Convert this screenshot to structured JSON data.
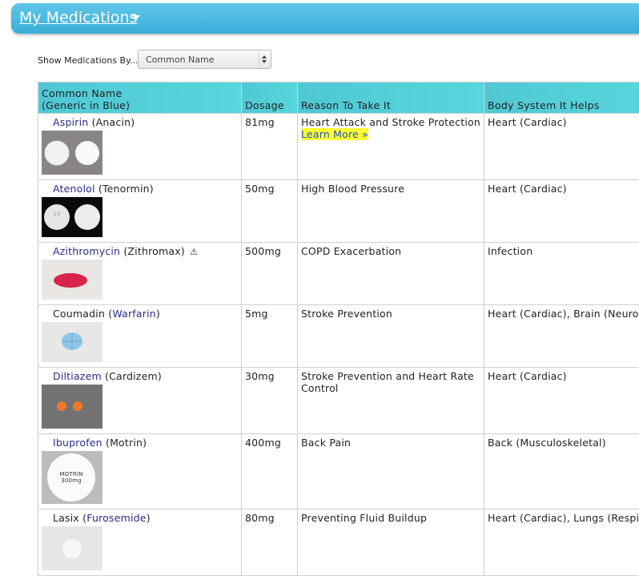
{
  "header": {
    "title": "My Medications"
  },
  "filter": {
    "label": "Show Medications By...",
    "selected": "Common Name"
  },
  "table": {
    "columns": [
      "Common Name\n(Generic in Blue)",
      "Dosage",
      "Reason To Take It",
      "Body System It Helps"
    ],
    "rows": [
      {
        "name_pre": "",
        "name_blue": "Aspirin",
        "name_post": " (Anacin)",
        "dosage": "81mg",
        "reason": "Heart Attack and Stroke Protection",
        "learn_more": "Learn More »",
        "body": "Heart (Cardiac)",
        "pill": "aspirin"
      },
      {
        "name_pre": "",
        "name_blue": "Atenolol",
        "name_post": " (Tenormin)",
        "dosage": "50mg",
        "reason": "High Blood Pressure",
        "learn_more": "",
        "body": "Heart (Cardiac)",
        "pill": "atenolol"
      },
      {
        "name_pre": "",
        "name_blue": "Azithromycin",
        "name_post": " (Zithromax)",
        "dosage": "500mg",
        "reason": "COPD Exacerbation",
        "learn_more": "",
        "body": "Infection",
        "pill": "azithromycin",
        "warning": "⚠"
      },
      {
        "name_pre": "Coumadin (",
        "name_blue": "Warfarin",
        "name_post": ")",
        "dosage": "5mg",
        "reason": "Stroke Prevention",
        "learn_more": "",
        "body": "Heart (Cardiac), Brain (Neurolo",
        "pill": "coumadin"
      },
      {
        "name_pre": "",
        "name_blue": "Diltiazem",
        "name_post": " (Cardizem)",
        "dosage": "30mg",
        "reason": "Stroke Prevention and Heart Rate Control",
        "learn_more": "",
        "body": "Heart (Cardiac)",
        "pill": "diltiazem"
      },
      {
        "name_pre": "",
        "name_blue": "Ibuprofen",
        "name_post": " (Motrin)",
        "dosage": "400mg",
        "reason": "Back Pain",
        "learn_more": "",
        "body": "Back (Musculoskeletal)",
        "pill": "ibuprofen",
        "imprint": "MOTRIN 300mg"
      },
      {
        "name_pre": "Lasix (",
        "name_blue": "Furosemide",
        "name_post": ")",
        "dosage": "80mg",
        "reason": "Preventing Fluid Buildup",
        "learn_more": "",
        "body": "Heart (Cardiac), Lungs (Respiro (Musculoskeletal)",
        "pill": "lasix"
      }
    ]
  }
}
